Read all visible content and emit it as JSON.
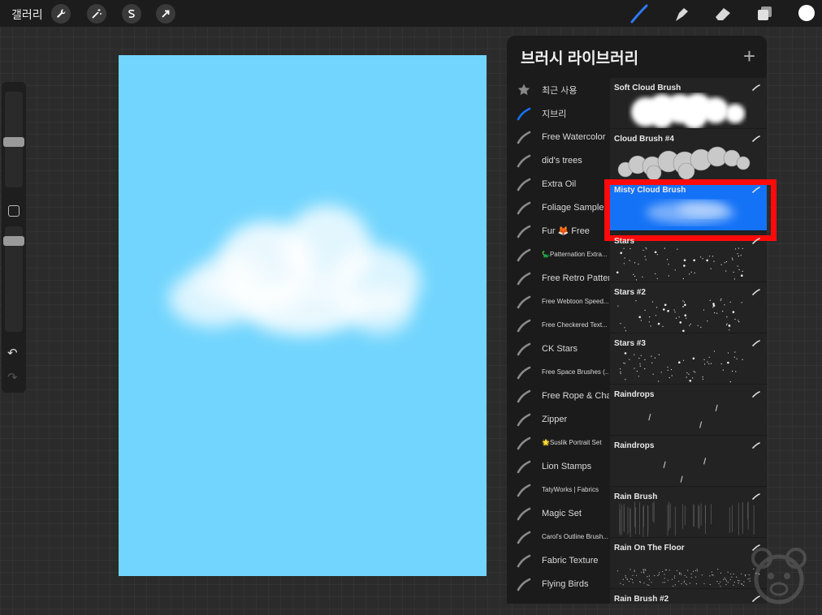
{
  "topbar": {
    "gallery_label": "갤러리",
    "left_tools": [
      {
        "icon": "wrench-icon",
        "name": "actions-button"
      },
      {
        "icon": "magic-wand-icon",
        "name": "adjustments-button"
      },
      {
        "icon": "selection-icon",
        "name": "selection-button"
      },
      {
        "icon": "transform-arrow-icon",
        "name": "transform-button"
      }
    ],
    "right_tools": [
      {
        "icon": "brush-icon",
        "name": "brush-tool-button",
        "active": true
      },
      {
        "icon": "smudge-icon",
        "name": "smudge-tool-button"
      },
      {
        "icon": "eraser-icon",
        "name": "eraser-tool-button"
      },
      {
        "icon": "layers-icon",
        "name": "layers-button"
      }
    ],
    "active_color": "#ffffff",
    "accent_color": "#2d7cf6"
  },
  "canvas": {
    "background_color": "#72d5fd"
  },
  "brush_library": {
    "title": "브러시 라이브러리",
    "add_label": "+",
    "sets": [
      {
        "label": "최근 사용",
        "icon": "star-icon"
      },
      {
        "label": "지브리",
        "icon": "brush-stroke-icon",
        "active": true
      },
      {
        "label": "Free Watercolor",
        "icon": "brush-stroke-icon"
      },
      {
        "label": "did's trees",
        "icon": "brush-stroke-icon"
      },
      {
        "label": "Extra Oil",
        "icon": "brush-stroke-icon"
      },
      {
        "label": "Foliage Sample",
        "icon": "brush-stroke-icon"
      },
      {
        "label": "Fur 🦊 Free",
        "icon": "brush-stroke-icon"
      },
      {
        "label": "🦕Patternation Extra...",
        "icon": "brush-stroke-icon",
        "small": true
      },
      {
        "label": "Free Retro Pattern",
        "icon": "brush-stroke-icon"
      },
      {
        "label": "Free Webtoon Speed...",
        "icon": "brush-stroke-icon",
        "small": true
      },
      {
        "label": "Free Checkered Text...",
        "icon": "brush-stroke-icon",
        "small": true
      },
      {
        "label": "CK Stars",
        "icon": "brush-stroke-icon"
      },
      {
        "label": "Free Space Brushes (...",
        "icon": "brush-stroke-icon",
        "small": true
      },
      {
        "label": "Free Rope & Chain",
        "icon": "brush-stroke-icon"
      },
      {
        "label": "Zipper",
        "icon": "brush-stroke-icon"
      },
      {
        "label": "🌟Suslik Portrait Set",
        "icon": "brush-stroke-icon",
        "small": true
      },
      {
        "label": "Lion Stamps",
        "icon": "brush-stroke-icon"
      },
      {
        "label": "TatyWorks | Fabrics",
        "icon": "brush-stroke-icon",
        "small": true
      },
      {
        "label": "Magic Set",
        "icon": "brush-stroke-icon"
      },
      {
        "label": "Carol's Outline Brush...",
        "icon": "brush-stroke-icon",
        "small": true
      },
      {
        "label": "Fabric Texture",
        "icon": "brush-stroke-icon"
      },
      {
        "label": "Flying Birds",
        "icon": "brush-stroke-icon"
      }
    ],
    "brushes": [
      {
        "name": "Soft Cloud Brush",
        "preview": "cloud-soft"
      },
      {
        "name": "Cloud Brush #4",
        "preview": "cloud-puffy"
      },
      {
        "name": "Misty Cloud Brush",
        "preview": "cloud-misty",
        "selected": true
      },
      {
        "name": "Stars",
        "preview": "stars"
      },
      {
        "name": "Stars #2",
        "preview": "stars"
      },
      {
        "name": "Stars #3",
        "preview": "stars"
      },
      {
        "name": "Raindrops",
        "preview": "raindrops"
      },
      {
        "name": "Raindrops",
        "preview": "raindrops"
      },
      {
        "name": "Rain Brush",
        "preview": "rain"
      },
      {
        "name": "Rain On The Floor",
        "preview": "rain-floor"
      },
      {
        "name": "Rain Brush #2",
        "preview": "rain"
      }
    ],
    "selected_highlight_color": "#1472f6",
    "selection_frame_color": "#ff0a0a"
  }
}
